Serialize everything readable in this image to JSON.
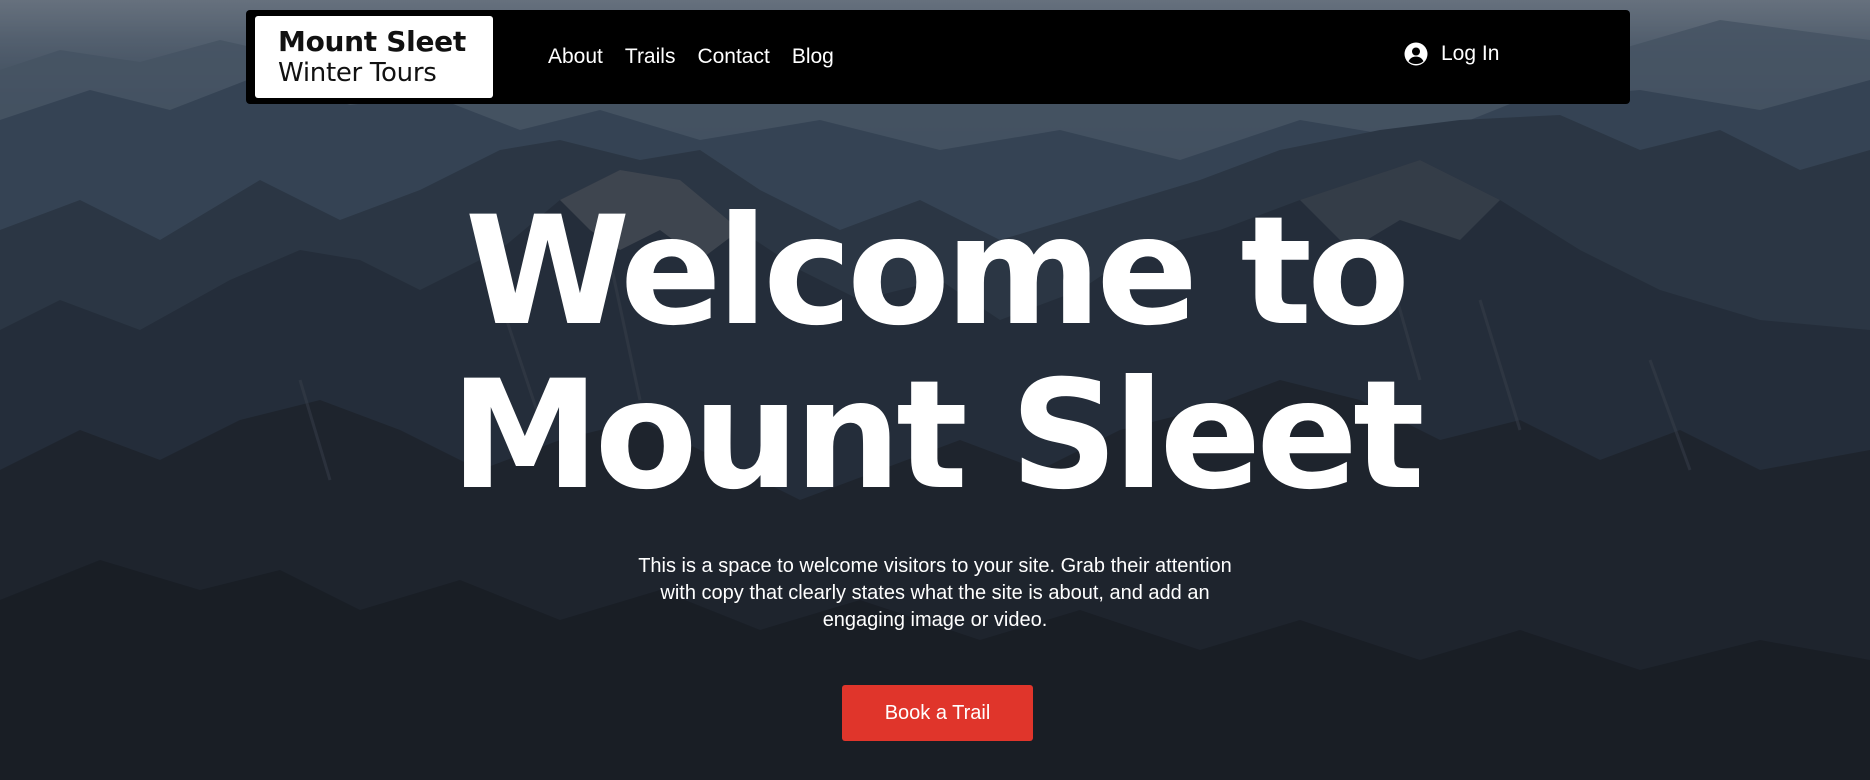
{
  "brand": {
    "title": "Mount Sleet",
    "subtitle": "Winter Tours"
  },
  "nav": {
    "items": [
      {
        "label": "About"
      },
      {
        "label": "Trails"
      },
      {
        "label": "Contact"
      },
      {
        "label": "Blog"
      }
    ]
  },
  "login": {
    "label": "Log In",
    "icon": "user-circle-icon"
  },
  "hero": {
    "title_line1": "Welcome to",
    "title_line2": "Mount Sleet",
    "text": "This is a space to welcome visitors to your site. Grab their attention with copy that clearly states what the site is about, and add an engaging image or video.",
    "cta_label": "Book a Trail",
    "background_image": "mountain-range-photo"
  },
  "colors": {
    "header_bg": "#000000",
    "logo_bg": "#ffffff",
    "cta_bg": "#e0352b",
    "text": "#ffffff"
  }
}
